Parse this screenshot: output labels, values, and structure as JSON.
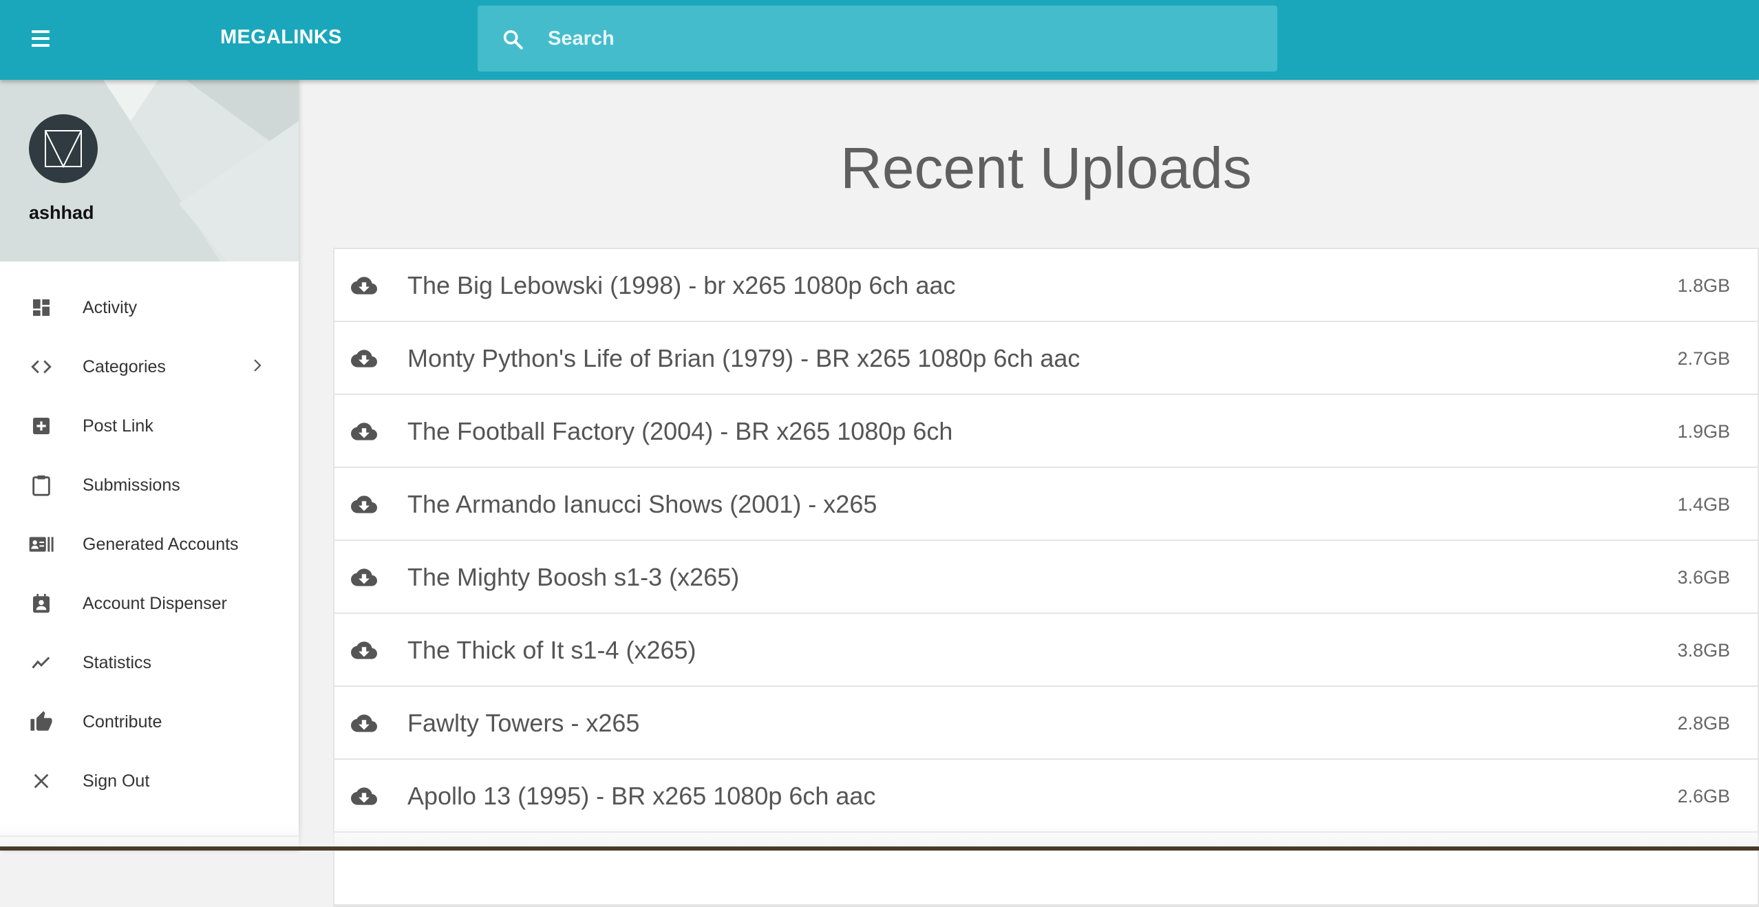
{
  "header": {
    "brand": "MEGALINKS",
    "search_placeholder": "Search",
    "bar_color": "#1aa7bb"
  },
  "sidebar": {
    "username": "ashhad",
    "items": [
      {
        "label": "Activity",
        "icon": "dashboard-icon"
      },
      {
        "label": "Categories",
        "icon": "code-brackets-icon",
        "has_submenu": true
      },
      {
        "label": "Post Link",
        "icon": "add-box-icon"
      },
      {
        "label": "Submissions",
        "icon": "clipboard-icon"
      },
      {
        "label": "Generated Accounts",
        "icon": "account-card-icon"
      },
      {
        "label": "Account Dispenser",
        "icon": "contact-calendar-icon"
      },
      {
        "label": "Statistics",
        "icon": "trending-icon"
      },
      {
        "label": "Contribute",
        "icon": "thumb-up-icon"
      },
      {
        "label": "Sign Out",
        "icon": "close-icon"
      }
    ]
  },
  "main": {
    "title": "Recent Uploads",
    "uploads": [
      {
        "title": "The Big Lebowski (1998) - br x265 1080p 6ch aac",
        "size": "1.8GB"
      },
      {
        "title": "Monty Python's Life of Brian (1979) - BR x265 1080p 6ch aac",
        "size": "2.7GB"
      },
      {
        "title": "The Football Factory (2004) - BR x265 1080p 6ch",
        "size": "1.9GB"
      },
      {
        "title": "The Armando Ianucci Shows (2001) - x265",
        "size": "1.4GB"
      },
      {
        "title": "The Mighty Boosh s1-3 (x265)",
        "size": "3.6GB"
      },
      {
        "title": "The Thick of It s1-4 (x265)",
        "size": "3.8GB"
      },
      {
        "title": "Fawlty Towers - x265",
        "size": "2.8GB"
      },
      {
        "title": "Apollo 13 (1995) - BR x265 1080p 6ch aac",
        "size": "2.6GB"
      }
    ]
  }
}
